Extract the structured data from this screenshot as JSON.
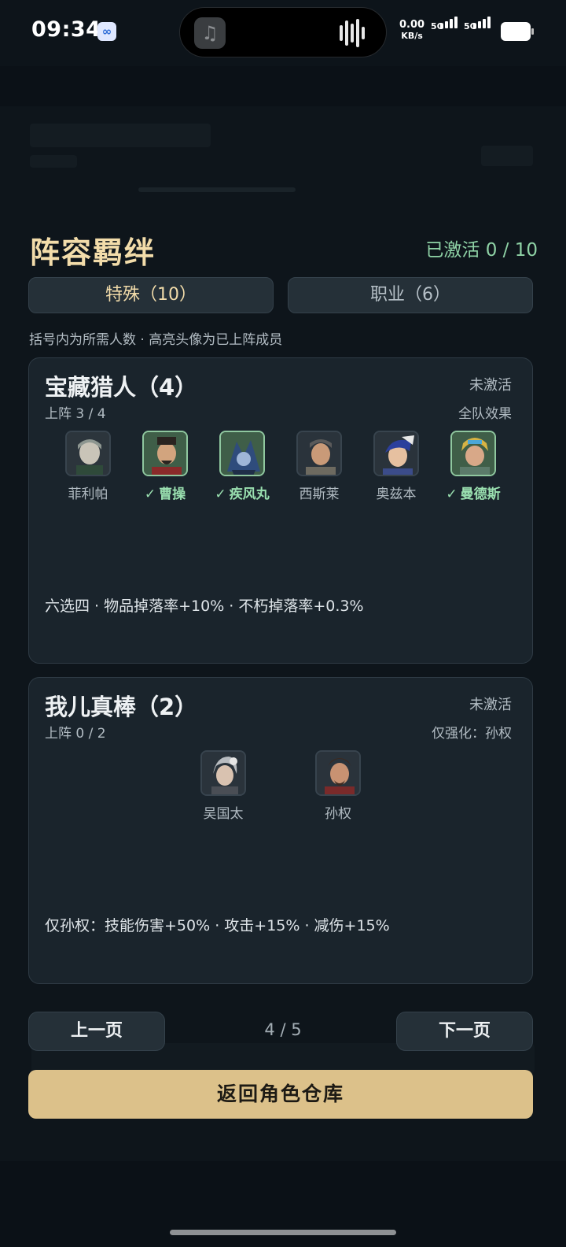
{
  "status_bar": {
    "time": "09:34",
    "net_speed_value": "0.00",
    "net_speed_unit": "KB/s",
    "sim1": "5G",
    "sim2": "5G"
  },
  "dialog": {
    "title": "阵容羁绊",
    "activated": "已激活 0 / 10",
    "tabs": [
      {
        "label": "特殊（10）",
        "active": true
      },
      {
        "label": "职业（6）",
        "active": false
      }
    ],
    "hint": "括号内为所需人数 · 高亮头像为已上阵成员",
    "cards": [
      {
        "title": "宝藏猎人（4）",
        "status": "未激活",
        "count": "上阵 3 / 4",
        "note": "全队效果",
        "members": [
          {
            "name": "菲利帕",
            "on": false
          },
          {
            "name": "曹操",
            "on": true
          },
          {
            "name": "疾风丸",
            "on": true
          },
          {
            "name": "西斯莱",
            "on": false
          },
          {
            "name": "奥兹本",
            "on": false
          },
          {
            "name": "曼德斯",
            "on": true
          }
        ],
        "effect": "六选四 · 物品掉落率+10% · 不朽掉落率+0.3%"
      },
      {
        "title": "我儿真棒（2）",
        "status": "未激活",
        "count": "上阵 0 / 2",
        "note": "仅强化：孙权",
        "members": [
          {
            "name": "吴国太",
            "on": false
          },
          {
            "name": "孙权",
            "on": false
          }
        ],
        "effect": "仅孙权：技能伤害+50% · 攻击+15% · 减伤+15%"
      }
    ],
    "prev_label": "上一页",
    "next_label": "下一页",
    "page": "4 / 5",
    "back_label": "返回角色仓库"
  },
  "check_mark": "✓",
  "colors": {
    "accent_gold": "#dcc18a",
    "title_gold": "#f2dcaa",
    "active_green": "#9ae0b0",
    "card_bg": "#1a242c"
  }
}
